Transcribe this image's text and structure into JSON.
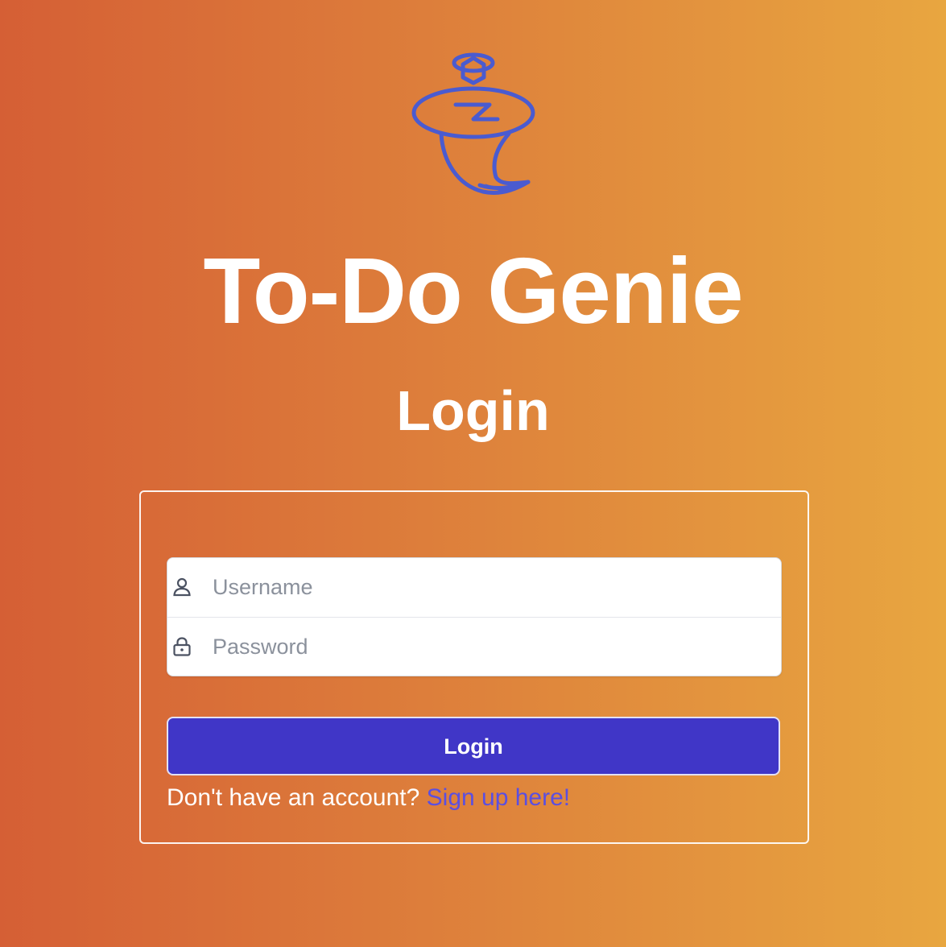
{
  "app": {
    "title": "To-Do Genie",
    "logo_icon": "genie-lamp-icon"
  },
  "page": {
    "title": "Login"
  },
  "form": {
    "username": {
      "placeholder": "Username",
      "value": "",
      "icon": "user-icon"
    },
    "password": {
      "placeholder": "Password",
      "value": "",
      "icon": "lock-icon"
    },
    "submit_label": "Login"
  },
  "signup": {
    "prompt": "Don't have an account?",
    "link_label": "Sign up here!"
  },
  "colors": {
    "background_start": "#d55f35",
    "background_end": "#e8a640",
    "logo_stroke": "#4a5bd0",
    "button": "#4036c7",
    "link": "#5b4fe0"
  }
}
